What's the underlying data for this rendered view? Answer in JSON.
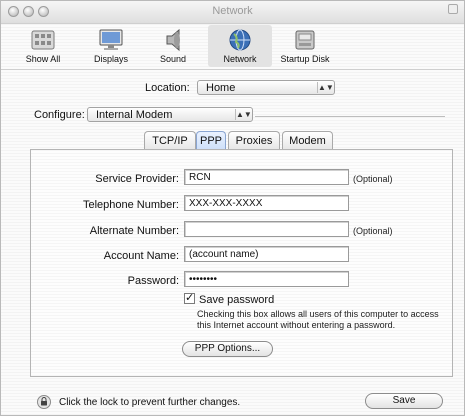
{
  "window": {
    "title": "Network"
  },
  "toolbar": {
    "items": [
      {
        "label": "Show All",
        "icon": "show-all-icon"
      },
      {
        "label": "Displays",
        "icon": "displays-icon"
      },
      {
        "label": "Sound",
        "icon": "sound-icon"
      },
      {
        "label": "Network",
        "icon": "network-globe-icon",
        "active": true
      },
      {
        "label": "Startup Disk",
        "icon": "startup-disk-icon"
      }
    ]
  },
  "location": {
    "label": "Location:",
    "value": "Home"
  },
  "configure": {
    "label": "Configure:",
    "value": "Internal Modem"
  },
  "tabs": [
    "TCP/IP",
    "PPP",
    "Proxies",
    "Modem"
  ],
  "selected_tab": "PPP",
  "form": {
    "service_provider": {
      "label": "Service Provider:",
      "value": "RCN",
      "note": "(Optional)"
    },
    "telephone_number": {
      "label": "Telephone Number:",
      "value": "XXX-XXX-XXXX"
    },
    "alternate_number": {
      "label": "Alternate Number:",
      "value": "",
      "note": "(Optional)"
    },
    "account_name": {
      "label": "Account Name:",
      "value": "(account name)"
    },
    "password": {
      "label": "Password:",
      "value": "••••••••"
    },
    "save_password": {
      "label": "Save password",
      "checked": true,
      "hint": "Checking this box allows all users of this computer to access this Internet account without entering a password."
    },
    "ppp_options_button": "PPP Options..."
  },
  "footer": {
    "lock_text": "Click the lock to prevent further changes.",
    "save_button": "Save"
  },
  "colors": {
    "selected_tab": "#cfe0f9",
    "accent": "#3b6fb6"
  }
}
